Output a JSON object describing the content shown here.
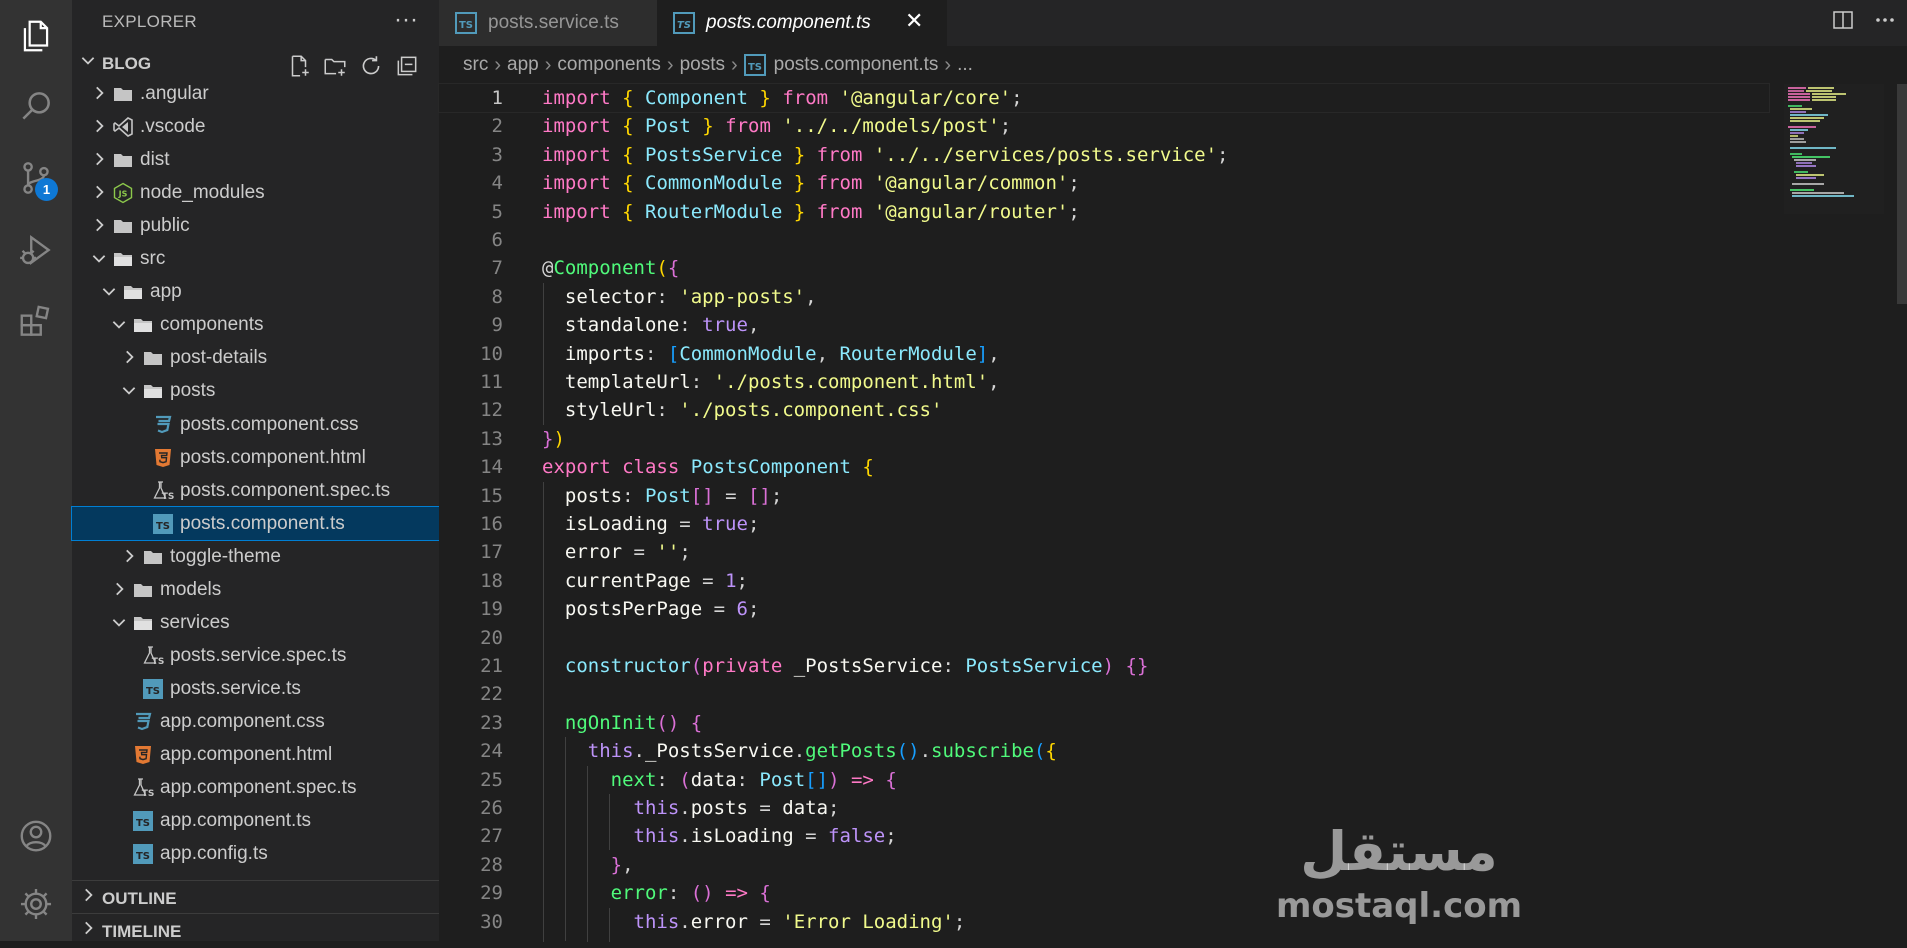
{
  "sidebar": {
    "title": "EXPLORER",
    "more": "···",
    "project": "BLOG",
    "outline": "OUTLINE",
    "timeline": "TIMELINE",
    "tree": [
      {
        "label": ".angular",
        "icon": "folder-icon",
        "expanded": false
      },
      {
        "label": ".vscode",
        "icon": "vscode-folder-icon",
        "expanded": false
      },
      {
        "label": "dist",
        "icon": "folder-icon",
        "expanded": false
      },
      {
        "label": "node_modules",
        "icon": "node-folder-icon",
        "expanded": false
      },
      {
        "label": "public",
        "icon": "folder-icon",
        "expanded": false
      },
      {
        "label": "src",
        "icon": "folder-open-icon",
        "expanded": true
      },
      {
        "label": "app",
        "icon": "folder-open-icon",
        "expanded": true
      },
      {
        "label": "components",
        "icon": "folder-open-icon",
        "expanded": true
      },
      {
        "label": "post-details",
        "icon": "folder-icon",
        "expanded": false
      },
      {
        "label": "posts",
        "icon": "folder-open-icon",
        "expanded": true
      },
      {
        "label": "posts.component.css",
        "icon": "css-file-icon"
      },
      {
        "label": "posts.component.html",
        "icon": "html-file-icon"
      },
      {
        "label": "posts.component.spec.ts",
        "icon": "spec-file-icon"
      },
      {
        "label": "posts.component.ts",
        "icon": "ts-file-icon",
        "selected": true
      },
      {
        "label": "toggle-theme",
        "icon": "folder-icon",
        "expanded": false
      },
      {
        "label": "models",
        "icon": "folder-icon",
        "expanded": false
      },
      {
        "label": "services",
        "icon": "folder-open-icon",
        "expanded": true
      },
      {
        "label": "posts.service.spec.ts",
        "icon": "spec-file-icon"
      },
      {
        "label": "posts.service.ts",
        "icon": "ts-file-icon"
      },
      {
        "label": "app.component.css",
        "icon": "css-file-icon"
      },
      {
        "label": "app.component.html",
        "icon": "html-file-icon"
      },
      {
        "label": "app.component.spec.ts",
        "icon": "spec-file-icon"
      },
      {
        "label": "app.component.ts",
        "icon": "ts-file-icon"
      },
      {
        "label": "app.config.ts",
        "icon": "ts-file-icon"
      }
    ]
  },
  "activity": {
    "scm_badge": "1"
  },
  "tabs": [
    {
      "label": "posts.service.ts",
      "active": false
    },
    {
      "label": "posts.component.ts",
      "active": true,
      "close": "✕"
    }
  ],
  "breadcrumb": [
    "src",
    "app",
    "components",
    "posts",
    "posts.component.ts",
    "..."
  ],
  "editor": {
    "active_line": 1,
    "line_numbers": [
      "1",
      "2",
      "3",
      "4",
      "5",
      "6",
      "7",
      "8",
      "9",
      "10",
      "11",
      "12",
      "13",
      "14",
      "15",
      "16",
      "17",
      "18",
      "19",
      "20",
      "21",
      "22",
      "23",
      "24",
      "25",
      "26",
      "27",
      "28",
      "29",
      "30"
    ]
  },
  "watermark": {
    "arabic": "مستقل",
    "latin": "mostaql.com"
  }
}
